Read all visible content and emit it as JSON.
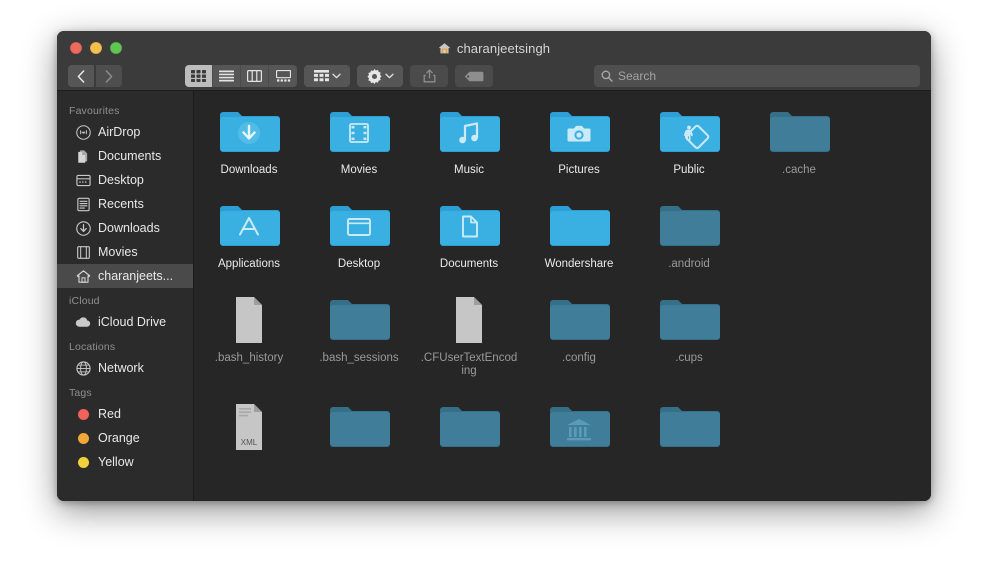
{
  "window": {
    "title": "charanjeetsingh",
    "title_icon": "home-icon"
  },
  "traffic_lights": [
    {
      "name": "close-button",
      "color": "#ed6a5f"
    },
    {
      "name": "minimize-button",
      "color": "#f5bf4f"
    },
    {
      "name": "maximize-button",
      "color": "#61c554"
    }
  ],
  "toolbar": {
    "back_label": "‹",
    "forward_label": "›",
    "view_modes": [
      {
        "name": "icon-view-button",
        "icon": "grid-icon",
        "active": true
      },
      {
        "name": "list-view-button",
        "icon": "list-icon",
        "active": false
      },
      {
        "name": "column-view-button",
        "icon": "columns-icon",
        "active": false
      },
      {
        "name": "gallery-view-button",
        "icon": "gallery-icon",
        "active": false
      }
    ],
    "group_button": {
      "name": "group-by-button",
      "icon": "grid-small-icon"
    },
    "action_button": {
      "name": "action-menu-button",
      "icon": "gear-icon"
    },
    "share_button": {
      "name": "share-button",
      "icon": "share-icon"
    },
    "tags_button": {
      "name": "tags-button",
      "icon": "tag-icon"
    }
  },
  "search": {
    "placeholder": "Search",
    "value": "",
    "icon": "search-icon"
  },
  "sidebar": {
    "sections": [
      {
        "title": "Favourites",
        "items": [
          {
            "label": "AirDrop",
            "icon": "airdrop-icon",
            "selected": false
          },
          {
            "label": "Documents",
            "icon": "documents-icon",
            "selected": false
          },
          {
            "label": "Desktop",
            "icon": "desktop-icon",
            "selected": false
          },
          {
            "label": "Recents",
            "icon": "recents-icon",
            "selected": false
          },
          {
            "label": "Downloads",
            "icon": "download-icon",
            "selected": false
          },
          {
            "label": "Movies",
            "icon": "movies-icon",
            "selected": false
          },
          {
            "label": "charanjeets...",
            "icon": "home-icon",
            "selected": true
          }
        ]
      },
      {
        "title": "iCloud",
        "items": [
          {
            "label": "iCloud Drive",
            "icon": "cloud-icon",
            "selected": false
          }
        ]
      },
      {
        "title": "Locations",
        "items": [
          {
            "label": "Network",
            "icon": "network-icon",
            "selected": false
          }
        ]
      },
      {
        "title": "Tags",
        "items": [
          {
            "label": "Red",
            "icon": "tag-dot-icon",
            "color": "#f0625a",
            "selected": false
          },
          {
            "label": "Orange",
            "icon": "tag-dot-icon",
            "color": "#f1a73a",
            "selected": false
          },
          {
            "label": "Yellow",
            "icon": "tag-dot-icon",
            "color": "#f2d23a",
            "selected": false
          }
        ]
      }
    ]
  },
  "files": [
    {
      "label": "Downloads",
      "type": "folder",
      "glyph": "download",
      "hidden": false
    },
    {
      "label": "Movies",
      "type": "folder",
      "glyph": "film",
      "hidden": false
    },
    {
      "label": "Music",
      "type": "folder",
      "glyph": "note",
      "hidden": false
    },
    {
      "label": "Pictures",
      "type": "folder",
      "glyph": "camera",
      "hidden": false
    },
    {
      "label": "Public",
      "type": "folder",
      "glyph": "pedestrian",
      "hidden": false
    },
    {
      "label": ".cache",
      "type": "folder",
      "glyph": "",
      "hidden": true
    },
    {
      "label": "Applications",
      "type": "folder",
      "glyph": "appstore",
      "hidden": false
    },
    {
      "label": "Desktop",
      "type": "folder",
      "glyph": "window",
      "hidden": false
    },
    {
      "label": "Documents",
      "type": "folder",
      "glyph": "page",
      "hidden": false
    },
    {
      "label": "Wondershare",
      "type": "folder",
      "glyph": "",
      "hidden": false
    },
    {
      "label": ".android",
      "type": "folder",
      "glyph": "",
      "hidden": true
    },
    {
      "label": ".bash_history",
      "type": "document",
      "glyph": "",
      "hidden": true
    },
    {
      "label": ".bash_sessions",
      "type": "folder",
      "glyph": "",
      "hidden": true
    },
    {
      "label": ".CFUserTextEncoding",
      "type": "document",
      "glyph": "",
      "hidden": true
    },
    {
      "label": ".config",
      "type": "folder",
      "glyph": "",
      "hidden": true
    },
    {
      "label": ".cups",
      "type": "folder",
      "glyph": "",
      "hidden": true
    },
    {
      "label": "",
      "type": "document",
      "glyph": "xml",
      "hidden": true
    },
    {
      "label": "",
      "type": "folder",
      "glyph": "",
      "hidden": true
    },
    {
      "label": "",
      "type": "folder",
      "glyph": "",
      "hidden": true
    },
    {
      "label": "",
      "type": "folder",
      "glyph": "library",
      "hidden": true
    },
    {
      "label": "",
      "type": "folder",
      "glyph": "",
      "hidden": true
    }
  ],
  "colors": {
    "folder_blue": "#3ab0e2",
    "folder_dim": "#3f7d99",
    "window_bg": "#262626",
    "sidebar_bg": "#2b2b2b",
    "titlebar_bg": "#3b3b3b"
  }
}
